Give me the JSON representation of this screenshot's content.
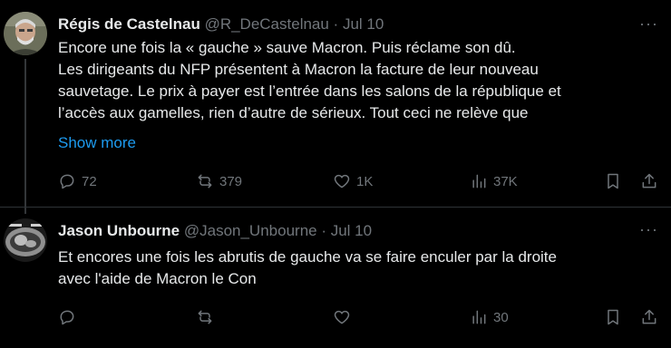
{
  "tweets": [
    {
      "author_name": "Régis de Castelnau",
      "meta": "@R_DeCastelnau · Jul 10",
      "lines": [
        "Encore une fois la « gauche » sauve Macron. Puis réclame son dû.",
        "Les dirigeants du NFP présentent à Macron la facture de leur nouveau",
        "sauvetage. Le prix à payer est l’entrée dans les salons de la république et",
        "l’accès aux gamelles, rien d’autre de sérieux. Tout ceci ne relève que"
      ],
      "show_more": "Show more",
      "replies": "72",
      "reposts": "379",
      "likes": "1K",
      "views": "37K"
    },
    {
      "author_name": "Jason Unbourne",
      "meta": "@Jason_Unbourne · Jul 10",
      "lines": [
        "Et encores une fois les abrutis de gauche va se faire enculer par la droite",
        "avec l'aide de Macron le Con"
      ],
      "replies": "",
      "reposts": "",
      "likes": "",
      "views": "30"
    }
  ],
  "more_glyph": "···",
  "icons": [
    "reply-icon",
    "repost-icon",
    "like-icon",
    "views-icon",
    "bookmark-icon",
    "share-icon"
  ]
}
